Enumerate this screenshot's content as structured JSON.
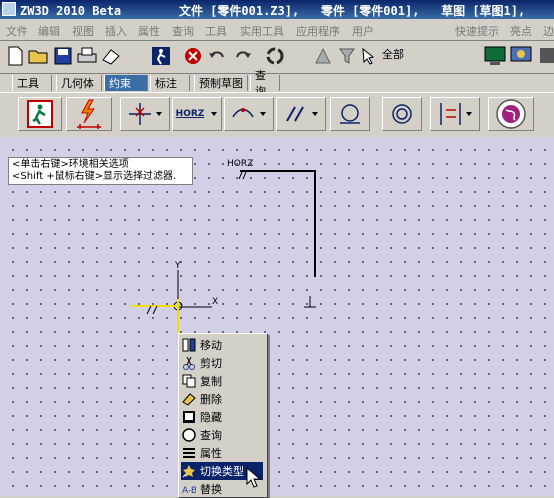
{
  "title": {
    "text": "ZW3D 2010 Beta        文件 [零件001.Z3],   零件 [零件001],   草图 [草图1],"
  },
  "menu": [
    "文件",
    "编辑",
    "视图",
    "插入",
    "属性",
    "查询",
    "工具",
    "实用工具",
    "应用程序",
    "用户",
    "快速提示",
    "亮点",
    "边"
  ],
  "toolbar1": {
    "filter_value": "全部",
    "icons": [
      "new-icon",
      "open-icon",
      "save-icon",
      "print-icon",
      "eraser-icon",
      "exit-icon",
      "cancel-icon",
      "undo-icon",
      "redo-icon",
      "refresh-icon",
      "help-icon",
      "filter-icon"
    ]
  },
  "tabs": [
    "工具",
    "几何体",
    "约束",
    "标注",
    "预制草图",
    "查询"
  ],
  "active_tab": "约束",
  "toolbar2": {
    "horz_label": "HORZ"
  },
  "canvas": {
    "hint_line1": "<单击右键>环境相关选项",
    "hint_line2": "<Shift +鼠标右键>显示选择过滤器.",
    "horz_label": "HORZ",
    "axis_y": "Y",
    "axis_x": "X"
  },
  "context_menu": [
    {
      "label": "移动",
      "icon": "move-icon"
    },
    {
      "label": "剪切",
      "icon": "scissors-icon"
    },
    {
      "label": "复制",
      "icon": "copy-icon"
    },
    {
      "label": "删除",
      "icon": "delete-icon"
    },
    {
      "label": "隐藏",
      "icon": "hide-icon"
    },
    {
      "label": "查询",
      "icon": "query-icon"
    },
    {
      "label": "属性",
      "icon": "properties-icon"
    },
    {
      "label": "切换类型",
      "icon": "toggle-type-icon"
    },
    {
      "label": "替换",
      "icon": "replace-icon"
    }
  ],
  "selected_menu_item": "切换类型"
}
